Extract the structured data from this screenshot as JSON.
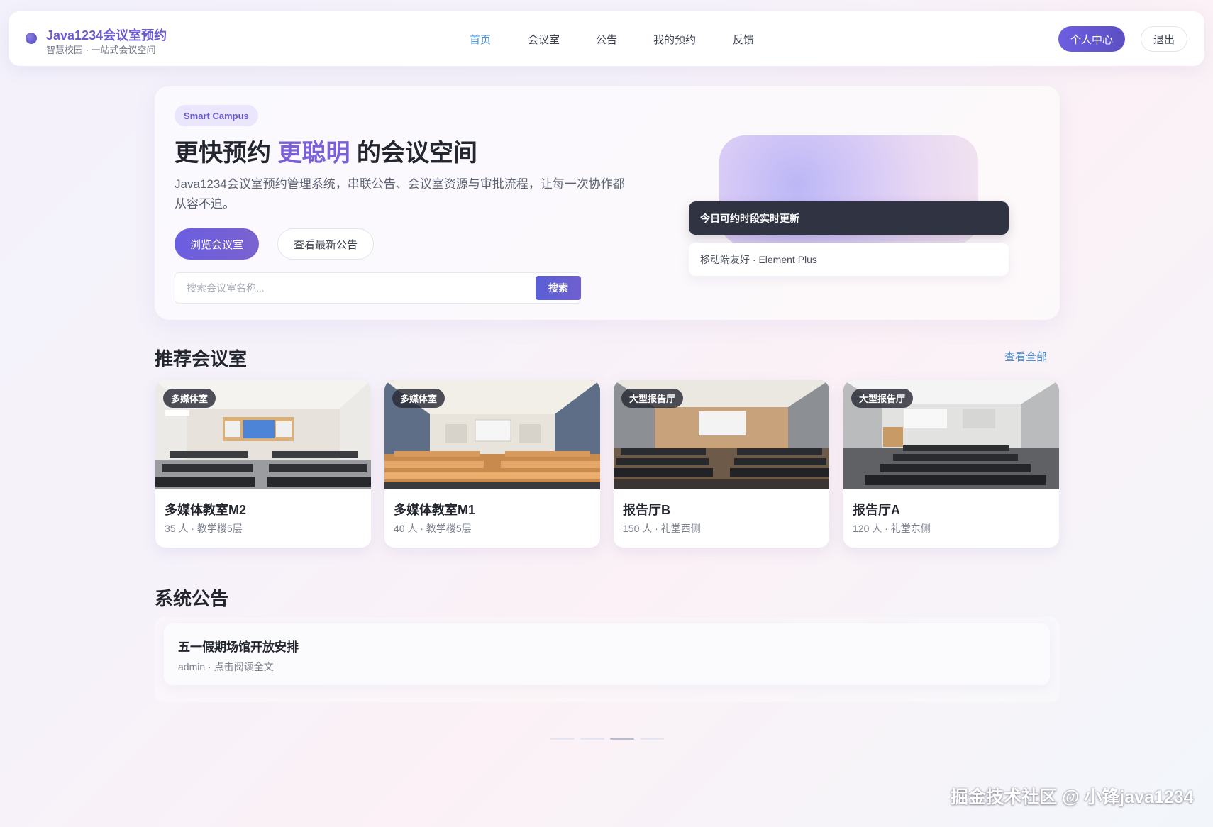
{
  "brand": {
    "title": "Java1234会议室预约",
    "subtitle": "智慧校园 · 一站式会议空间"
  },
  "nav": {
    "items": [
      "首页",
      "会议室",
      "公告",
      "我的预约",
      "反馈"
    ],
    "active_index": 0
  },
  "header_actions": {
    "profile": "个人中心",
    "logout": "退出"
  },
  "hero": {
    "badge": "Smart Campus",
    "title_prefix": "更快预约",
    "title_accent": "更聪明",
    "title_suffix": "的会议空间",
    "description": "Java1234会议室预约管理系统，串联公告、会议室资源与审批流程，让每一次协作都从容不迫。",
    "browse_button": "浏览会议室",
    "notice_button": "查看最新公告",
    "search_placeholder": "搜索会议室名称...",
    "search_button": "搜索",
    "status_dark": "今日可约时段实时更新",
    "status_light": "移动端友好 · Element Plus"
  },
  "rooms_section": {
    "title": "推荐会议室",
    "view_all": "查看全部"
  },
  "rooms": [
    {
      "tag": "多媒体室",
      "name": "多媒体教室M2",
      "meta": "35 人 · 教学楼5层"
    },
    {
      "tag": "多媒体室",
      "name": "多媒体教室M1",
      "meta": "40 人 · 教学楼5层"
    },
    {
      "tag": "大型报告厅",
      "name": "报告厅B",
      "meta": "150 人 · 礼堂西侧"
    },
    {
      "tag": "大型报告厅",
      "name": "报告厅A",
      "meta": "120 人 · 礼堂东侧"
    }
  ],
  "notices_section": {
    "title": "系统公告"
  },
  "notices": [
    {
      "title": "五一假期场馆开放安排",
      "meta": "admin · 点击阅读全文"
    }
  ],
  "pagination": {
    "count": 4,
    "active_index": 2
  },
  "watermark": "掘金技术社区 @ 小锋java1234",
  "colors": {
    "primary": "#6a5bd0",
    "link": "#4a8fd6",
    "dark_card": "#2f3342"
  }
}
